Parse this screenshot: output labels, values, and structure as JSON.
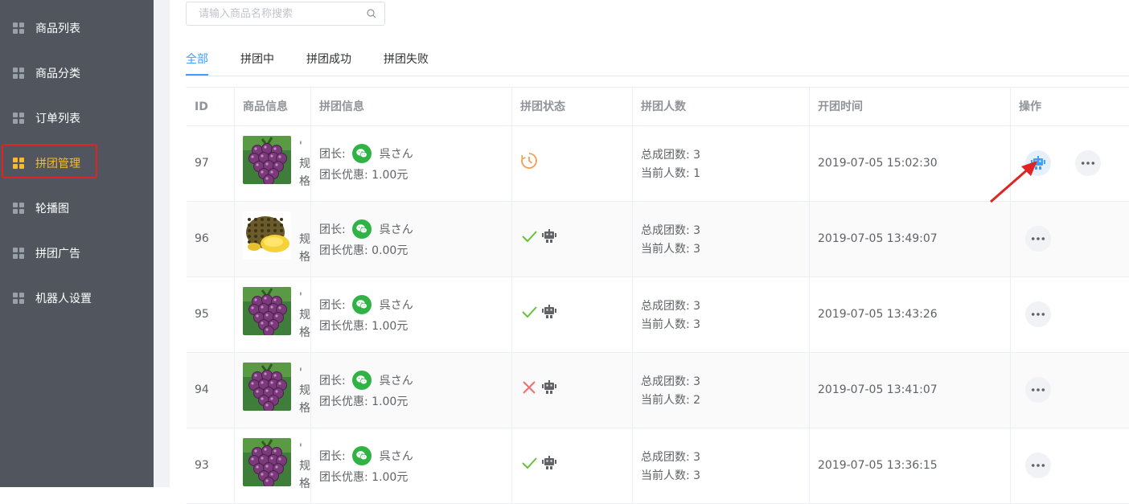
{
  "sidebar": {
    "items": [
      {
        "label": "商品列表",
        "active": false
      },
      {
        "label": "商品分类",
        "active": false
      },
      {
        "label": "订单列表",
        "active": false
      },
      {
        "label": "拼团管理",
        "active": true
      },
      {
        "label": "轮播图",
        "active": false
      },
      {
        "label": "拼团广告",
        "active": false
      },
      {
        "label": "机器人设置",
        "active": false
      }
    ]
  },
  "search": {
    "placeholder": "请输入商品名称搜索",
    "value": ""
  },
  "tabs": [
    {
      "label": "全部",
      "active": true
    },
    {
      "label": "拼团中",
      "active": false
    },
    {
      "label": "拼团成功",
      "active": false
    },
    {
      "label": "拼团失败",
      "active": false
    }
  ],
  "table": {
    "headers": [
      "ID",
      "商品信息",
      "拼团信息",
      "拼团状态",
      "拼团人数",
      "开团时间",
      "操作"
    ],
    "rows": [
      {
        "id": "97",
        "product_side": [
          "'",
          "规",
          "格"
        ],
        "product_image": "grape",
        "leader_label": "团长:",
        "leader_name": "呉さん",
        "discount_label": "团长优惠:",
        "discount": "1.00元",
        "status": "in-progress",
        "robot": false,
        "total_label": "总成团数:",
        "total": "3",
        "current_label": "当前人数:",
        "current": "1",
        "time": "2019-07-05 15:02:30",
        "ops": [
          "robot",
          "more"
        ]
      },
      {
        "id": "96",
        "product_side": [
          "",
          "规",
          "格"
        ],
        "product_image": "durian",
        "leader_label": "团长:",
        "leader_name": "呉さん",
        "discount_label": "团长优惠:",
        "discount": "0.00元",
        "status": "success",
        "robot": true,
        "total_label": "总成团数:",
        "total": "3",
        "current_label": "当前人数:",
        "current": "3",
        "time": "2019-07-05 13:49:07",
        "ops": [
          "more"
        ]
      },
      {
        "id": "95",
        "product_side": [
          "'",
          "规",
          "格"
        ],
        "product_image": "grape",
        "leader_label": "团长:",
        "leader_name": "呉さん",
        "discount_label": "团长优惠:",
        "discount": "1.00元",
        "status": "success",
        "robot": true,
        "total_label": "总成团数:",
        "total": "3",
        "current_label": "当前人数:",
        "current": "3",
        "time": "2019-07-05 13:43:26",
        "ops": [
          "more"
        ]
      },
      {
        "id": "94",
        "product_side": [
          "'",
          "规",
          "格"
        ],
        "product_image": "grape",
        "leader_label": "团长:",
        "leader_name": "呉さん",
        "discount_label": "团长优惠:",
        "discount": "1.00元",
        "status": "failed",
        "robot": true,
        "total_label": "总成团数:",
        "total": "3",
        "current_label": "当前人数:",
        "current": "2",
        "time": "2019-07-05 13:41:07",
        "ops": [
          "more"
        ]
      },
      {
        "id": "93",
        "product_side": [
          "'",
          "规",
          "格"
        ],
        "product_image": "grape",
        "leader_label": "团长:",
        "leader_name": "呉さん",
        "discount_label": "团长优惠:",
        "discount": "1.00元",
        "status": "success",
        "robot": true,
        "total_label": "总成团数:",
        "total": "3",
        "current_label": "当前人数:",
        "current": "3",
        "time": "2019-07-05 13:36:15",
        "ops": [
          "more"
        ]
      }
    ]
  },
  "colors": {
    "sidebar_bg": "#51565e",
    "active_text": "#f7ba2a",
    "accent_blue": "#409eff",
    "success_green": "#67c23a",
    "fail_red": "#f56c6c",
    "pending_orange": "#f0a050",
    "wechat_green": "#2fb344",
    "annotation_red": "#e02424"
  }
}
